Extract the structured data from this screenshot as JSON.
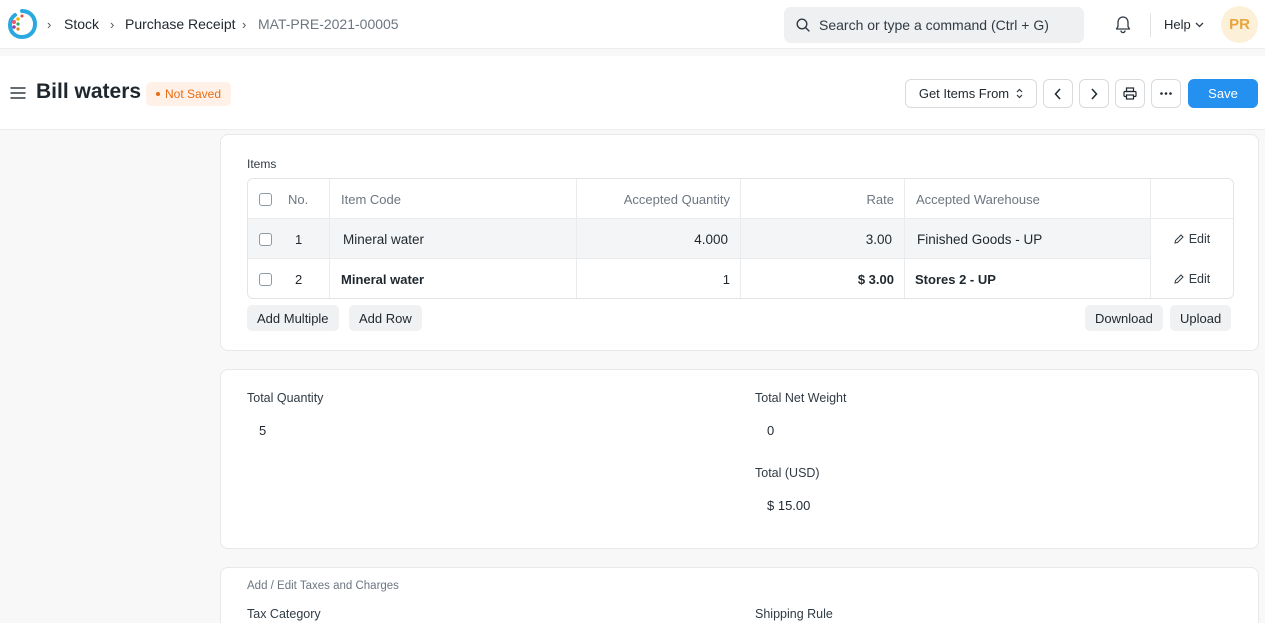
{
  "navbar": {
    "breadcrumbs": [
      "Stock",
      "Purchase Receipt",
      "MAT-PRE-2021-00005"
    ],
    "search_placeholder": "Search or type a command (Ctrl + G)",
    "help_label": "Help",
    "avatar_initials": "PR"
  },
  "page": {
    "title": "Bill waters",
    "status": "Not Saved",
    "get_items_label": "Get Items From",
    "save_label": "Save"
  },
  "items_section": {
    "label": "Items",
    "columns": [
      "No.",
      "Item Code",
      "Accepted Quantity",
      "Rate",
      "Accepted Warehouse"
    ],
    "rows": [
      {
        "no": "1",
        "item_code": "Mineral water",
        "qty": "4.000",
        "rate": "3.00",
        "warehouse": "Finished Goods - UP",
        "edit": "Edit"
      },
      {
        "no": "2",
        "item_code": "Mineral water",
        "qty": "1",
        "rate": "$ 3.00",
        "warehouse": "Stores 2 - UP",
        "edit": "Edit"
      }
    ],
    "add_multiple_label": "Add Multiple",
    "add_row_label": "Add Row",
    "download_label": "Download",
    "upload_label": "Upload"
  },
  "totals": {
    "total_quantity_label": "Total Quantity",
    "total_quantity": "5",
    "total_net_weight_label": "Total Net Weight",
    "total_net_weight": "0",
    "total_usd_label": "Total (USD)",
    "total_usd": "$ 15.00"
  },
  "taxes": {
    "section_label": "Add / Edit Taxes and Charges",
    "tax_category_label": "Tax Category",
    "shipping_rule_label": "Shipping Rule"
  },
  "colors": {
    "primary": "#2490ef",
    "status": "#e86c13",
    "avatar_bg": "#fdf0d8"
  }
}
